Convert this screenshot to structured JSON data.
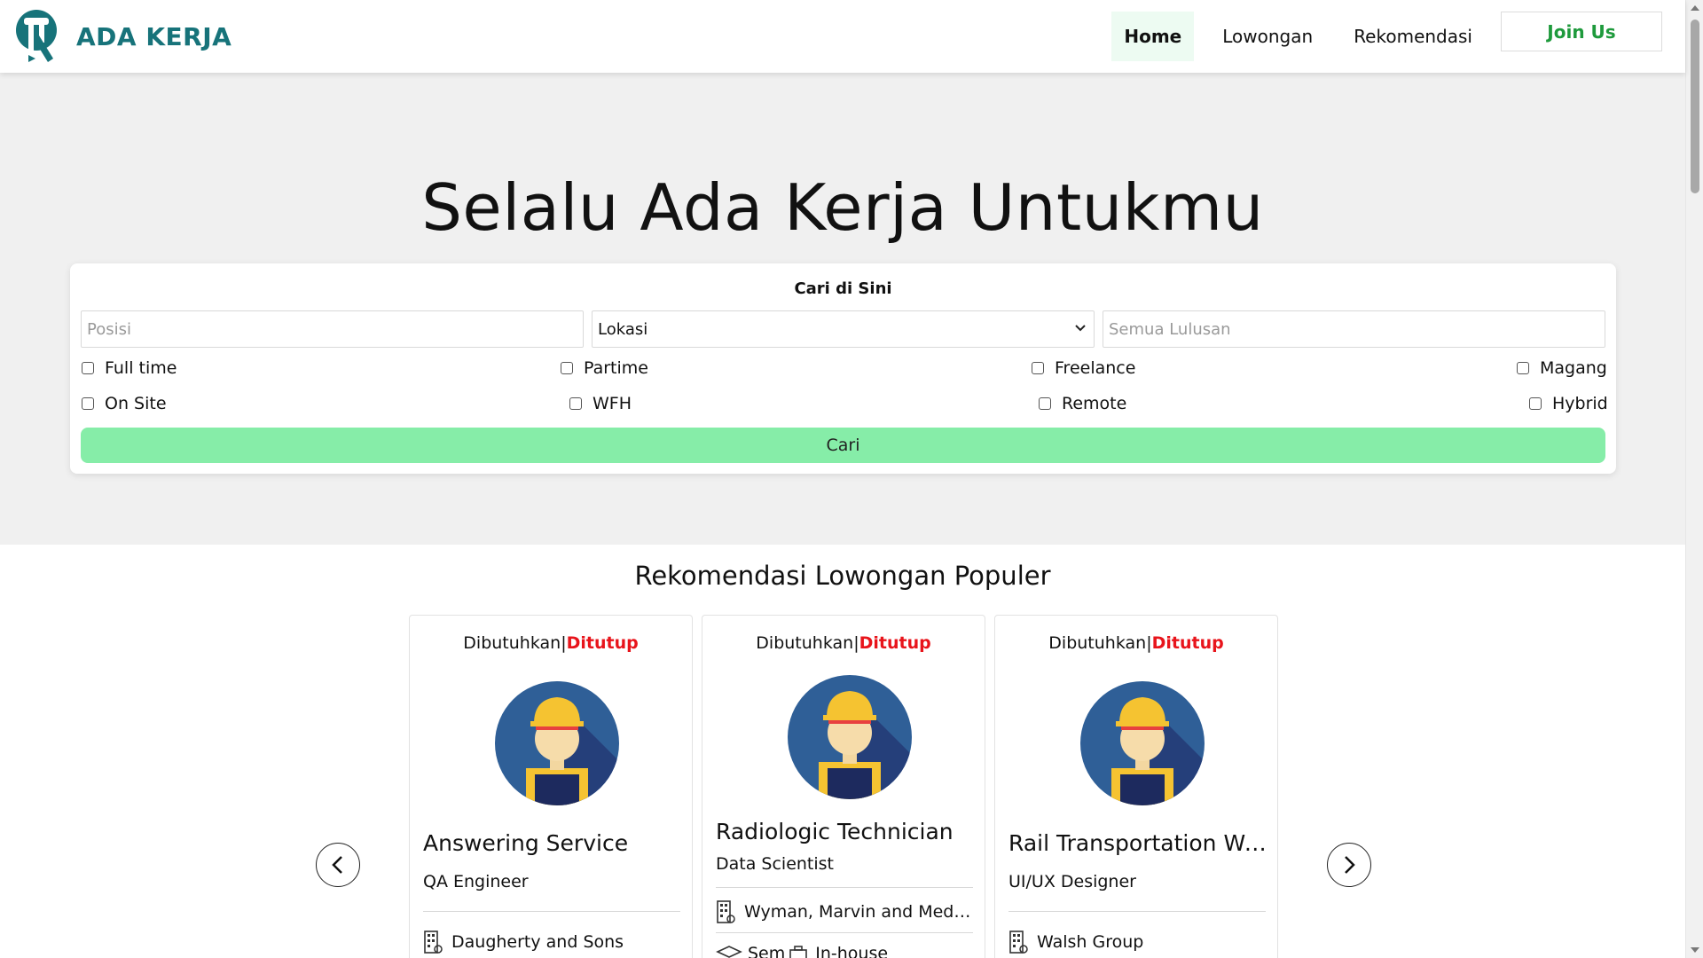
{
  "brand": {
    "name": "ADA KERJA",
    "logo_icon": "briefcase-person-logo",
    "color": "#17737a"
  },
  "nav": {
    "items": [
      {
        "label": "Home",
        "active": true
      },
      {
        "label": "Lowongan",
        "active": false
      },
      {
        "label": "Rekomendasi",
        "active": false
      }
    ],
    "join_label": "Join Us"
  },
  "hero": {
    "title": "Selalu Ada Kerja Untukmu",
    "search": {
      "title": "Cari di Sini",
      "position_placeholder": "Posisi",
      "location_value": "Lokasi",
      "education_placeholder": "Semua Lulusan",
      "job_types": [
        "Full time",
        "Partime",
        "Freelance",
        "Magang"
      ],
      "work_modes": [
        "On Site",
        "WFH",
        "Remote",
        "Hybrid"
      ],
      "button_label": "Cari",
      "button_color": "#86eda8"
    }
  },
  "recommendations": {
    "title": "Rekomendasi Lowongan Populer",
    "status_needed": "Dibutuhkan",
    "status_separator": "|",
    "status_closed": "Ditutup",
    "cards": [
      {
        "title": "Answering Service",
        "role": "QA Engineer",
        "company": "Daugherty and Sons"
      },
      {
        "title": "Radiologic Technician",
        "role": "Data Scientist",
        "company": "Wyman, Marvin and Medh...",
        "extra_left": "Sem",
        "extra_right": "In-house"
      },
      {
        "title": "Rail Transportation Wo...",
        "role": "UI/UX Designer",
        "company": "Walsh Group"
      }
    ],
    "prev_icon": "chevron-left-icon",
    "next_icon": "chevron-right-icon"
  },
  "colors": {
    "closed": "#e8141b",
    "join": "#1e9a3c",
    "active_nav_bg": "#edfbf2"
  }
}
